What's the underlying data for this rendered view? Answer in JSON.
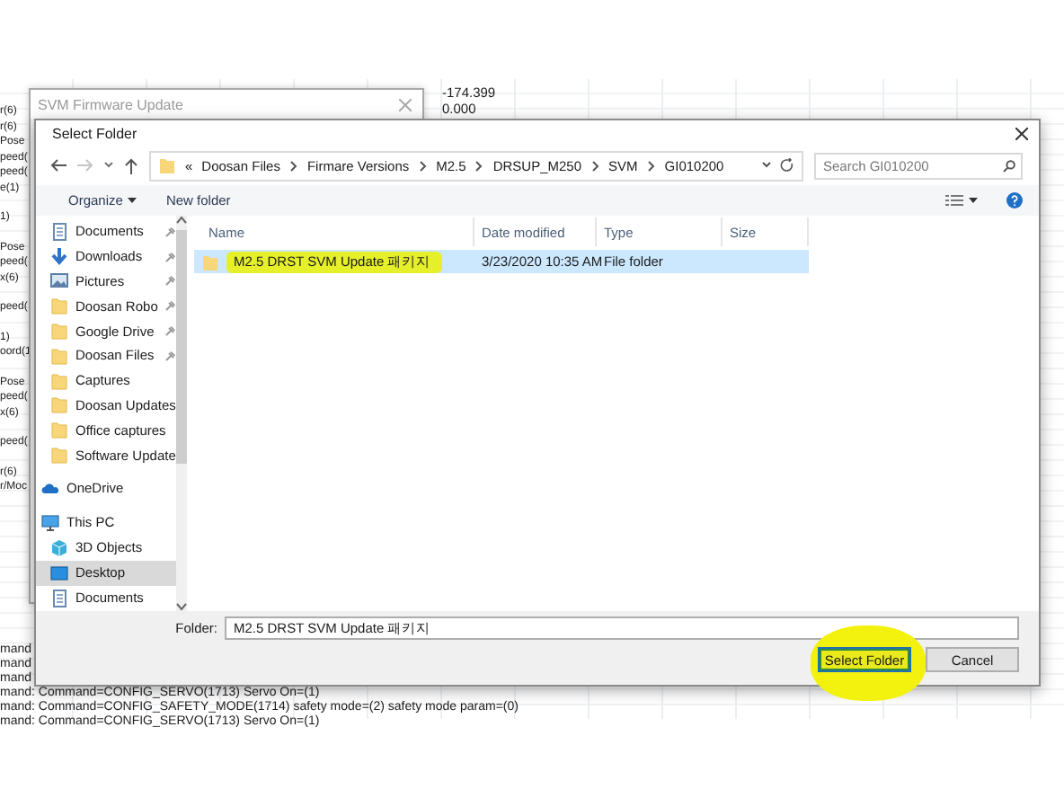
{
  "background_app": {
    "values": [
      "-174.399",
      "0.000"
    ],
    "left_fragments": [
      {
        "lines": [
          "r(6)",
          "r(6)",
          "Pose",
          "peed(",
          "peed(",
          "e(1)"
        ]
      },
      {
        "lines": [
          "1)"
        ]
      },
      {
        "lines": [
          "Pose",
          "peed(",
          "x(6)"
        ]
      },
      {
        "lines": [
          "peed("
        ]
      },
      {
        "lines": [
          "1)",
          "oord(1"
        ]
      },
      {
        "lines": [
          "Pose",
          "peed(",
          "x(6)"
        ]
      },
      {
        "lines": [
          "peed("
        ]
      },
      {
        "lines": [
          "r(6)",
          "r/Moc"
        ]
      }
    ],
    "log_lines": [
      "mand",
      "mand",
      "mand",
      "mand: Command=CONFIG_SERVO(1713) Servo On=(1)",
      "mand: Command=CONFIG_SAFETY_MODE(1714) safety mode=(2) safety mode param=(0)",
      "mand: Command=CONFIG_SERVO(1713) Servo On=(1)"
    ]
  },
  "parent_window": {
    "title": "SVM Firmware Update"
  },
  "dialog": {
    "title": "Select Folder",
    "address": {
      "overflow": "«",
      "segments": [
        "Doosan Files",
        "Firmare Versions",
        "M2.5",
        "DRSUP_M250",
        "SVM",
        "GI010200"
      ]
    },
    "search": {
      "placeholder": "Search GI010200"
    },
    "toolbar": {
      "organize": "Organize",
      "new_folder": "New folder"
    },
    "nav_pane": {
      "quick_access": [
        {
          "label": "Documents",
          "kind": "documents",
          "pinned": true
        },
        {
          "label": "Downloads",
          "kind": "downloads",
          "pinned": true
        },
        {
          "label": "Pictures",
          "kind": "pictures",
          "pinned": true
        },
        {
          "label": "Doosan Robo",
          "kind": "folder",
          "pinned": true
        },
        {
          "label": "Google Drive",
          "kind": "folder",
          "pinned": true
        },
        {
          "label": "Doosan Files",
          "kind": "folder",
          "pinned": true
        },
        {
          "label": "Captures",
          "kind": "folder",
          "pinned": false
        },
        {
          "label": "Doosan Updates",
          "kind": "folder",
          "pinned": false
        },
        {
          "label": "Office captures",
          "kind": "folder",
          "pinned": false
        },
        {
          "label": "Software Update",
          "kind": "folder",
          "pinned": false
        }
      ],
      "locations": [
        {
          "label": "OneDrive",
          "kind": "cloud",
          "selected": false
        },
        {
          "label": "This PC",
          "kind": "pc",
          "selected": false,
          "children": [
            {
              "label": "3D Objects",
              "kind": "cube",
              "selected": false
            },
            {
              "label": "Desktop",
              "kind": "desktop",
              "selected": true
            },
            {
              "label": "Documents",
              "kind": "documents",
              "selected": false
            }
          ]
        }
      ]
    },
    "columns": [
      "Name",
      "Date modified",
      "Type",
      "Size"
    ],
    "rows": [
      {
        "name": "M2.5 DRST SVM Update 패키지",
        "date": "3/23/2020 10:35 AM",
        "type": "File folder",
        "selected": true,
        "highlighted": true
      }
    ],
    "folder_label": "Folder:",
    "folder_value": "M2.5 DRST SVM Update 패키지",
    "buttons": [
      {
        "label": "Select Folder",
        "default": true,
        "highlighted": true
      },
      {
        "label": "Cancel",
        "default": false,
        "highlighted": false
      }
    ]
  }
}
